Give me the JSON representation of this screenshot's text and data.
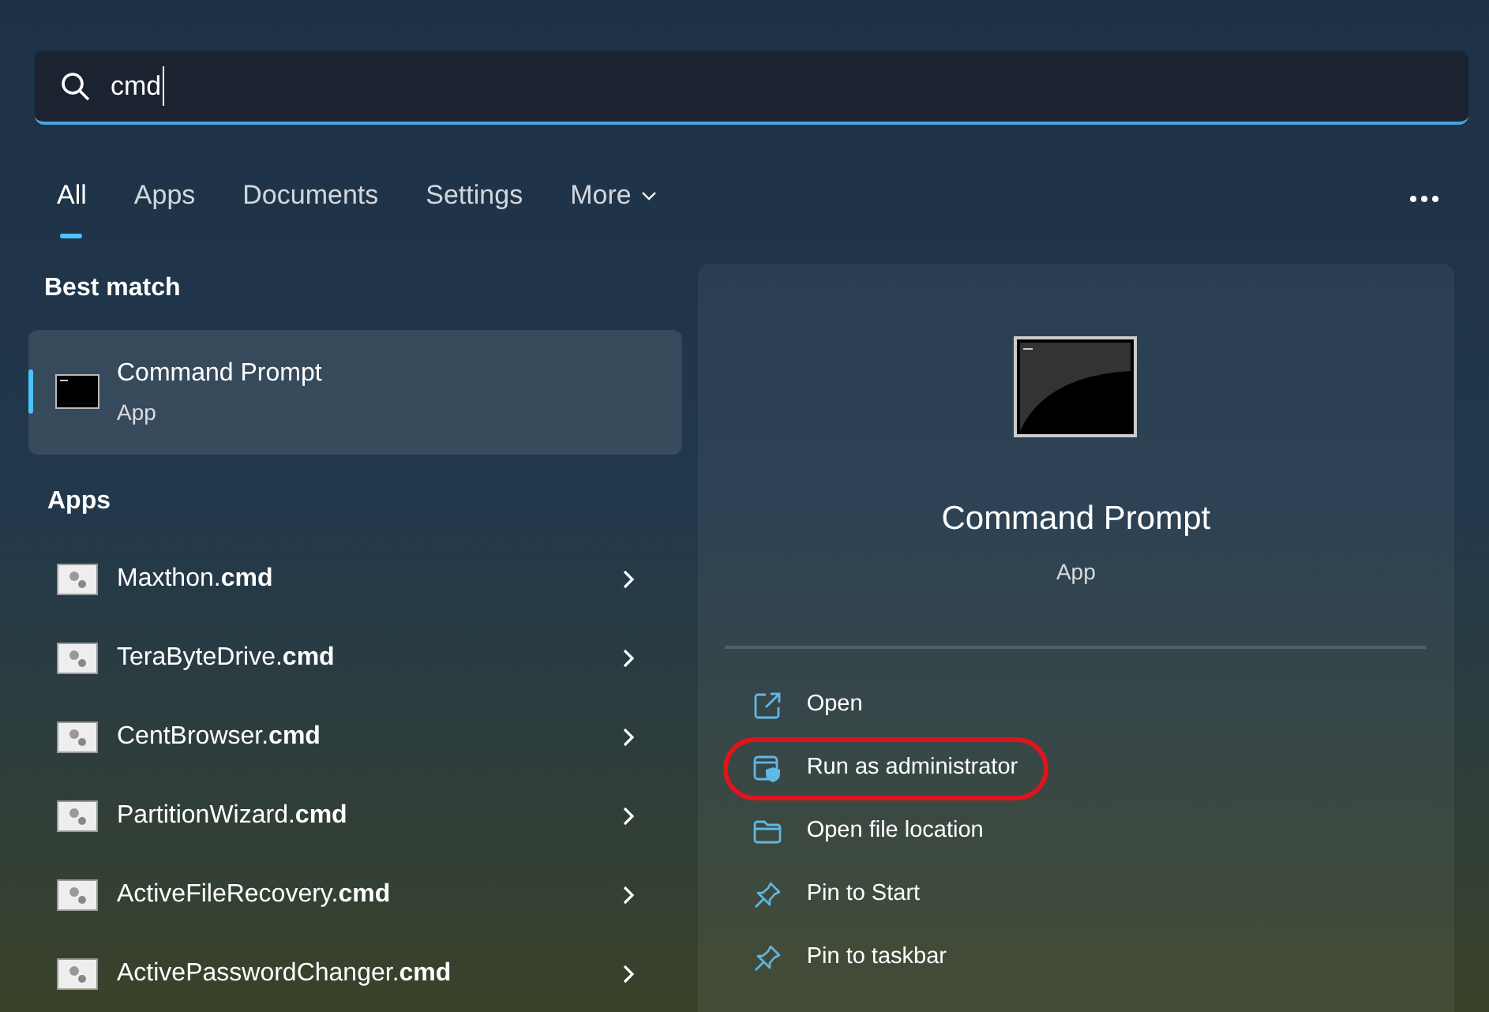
{
  "search": {
    "value": "cmd"
  },
  "tabs": [
    {
      "label": "All",
      "selected": true,
      "has_menu": false
    },
    {
      "label": "Apps",
      "selected": false,
      "has_menu": false
    },
    {
      "label": "Documents",
      "selected": false,
      "has_menu": false
    },
    {
      "label": "Settings",
      "selected": false,
      "has_menu": false
    },
    {
      "label": "More",
      "selected": false,
      "has_menu": true
    }
  ],
  "best_match": {
    "heading": "Best match",
    "title": "Command Prompt",
    "subtitle": "App",
    "selected": true
  },
  "apps": {
    "heading": "Apps",
    "items": [
      {
        "label": "Maxthon.**cmd**"
      },
      {
        "label": "TeraByteDrive.**cmd**"
      },
      {
        "label": "CentBrowser.**cmd**"
      },
      {
        "label": "PartitionWizard.**cmd**"
      },
      {
        "label": "ActiveFileRecovery.**cmd**"
      },
      {
        "label": "ActivePasswordChanger.**cmd**"
      }
    ]
  },
  "details": {
    "title": "Command Prompt",
    "subtitle": "App",
    "actions": [
      {
        "kind": "open",
        "label": "Open",
        "highlighted": false
      },
      {
        "kind": "admin",
        "label": "Run as administrator",
        "highlighted": true
      },
      {
        "kind": "folder",
        "label": "Open file location",
        "highlighted": false
      },
      {
        "kind": "pin",
        "label": "Pin to Start",
        "highlighted": false
      },
      {
        "kind": "pin",
        "label": "Pin to taskbar",
        "highlighted": false
      }
    ]
  }
}
